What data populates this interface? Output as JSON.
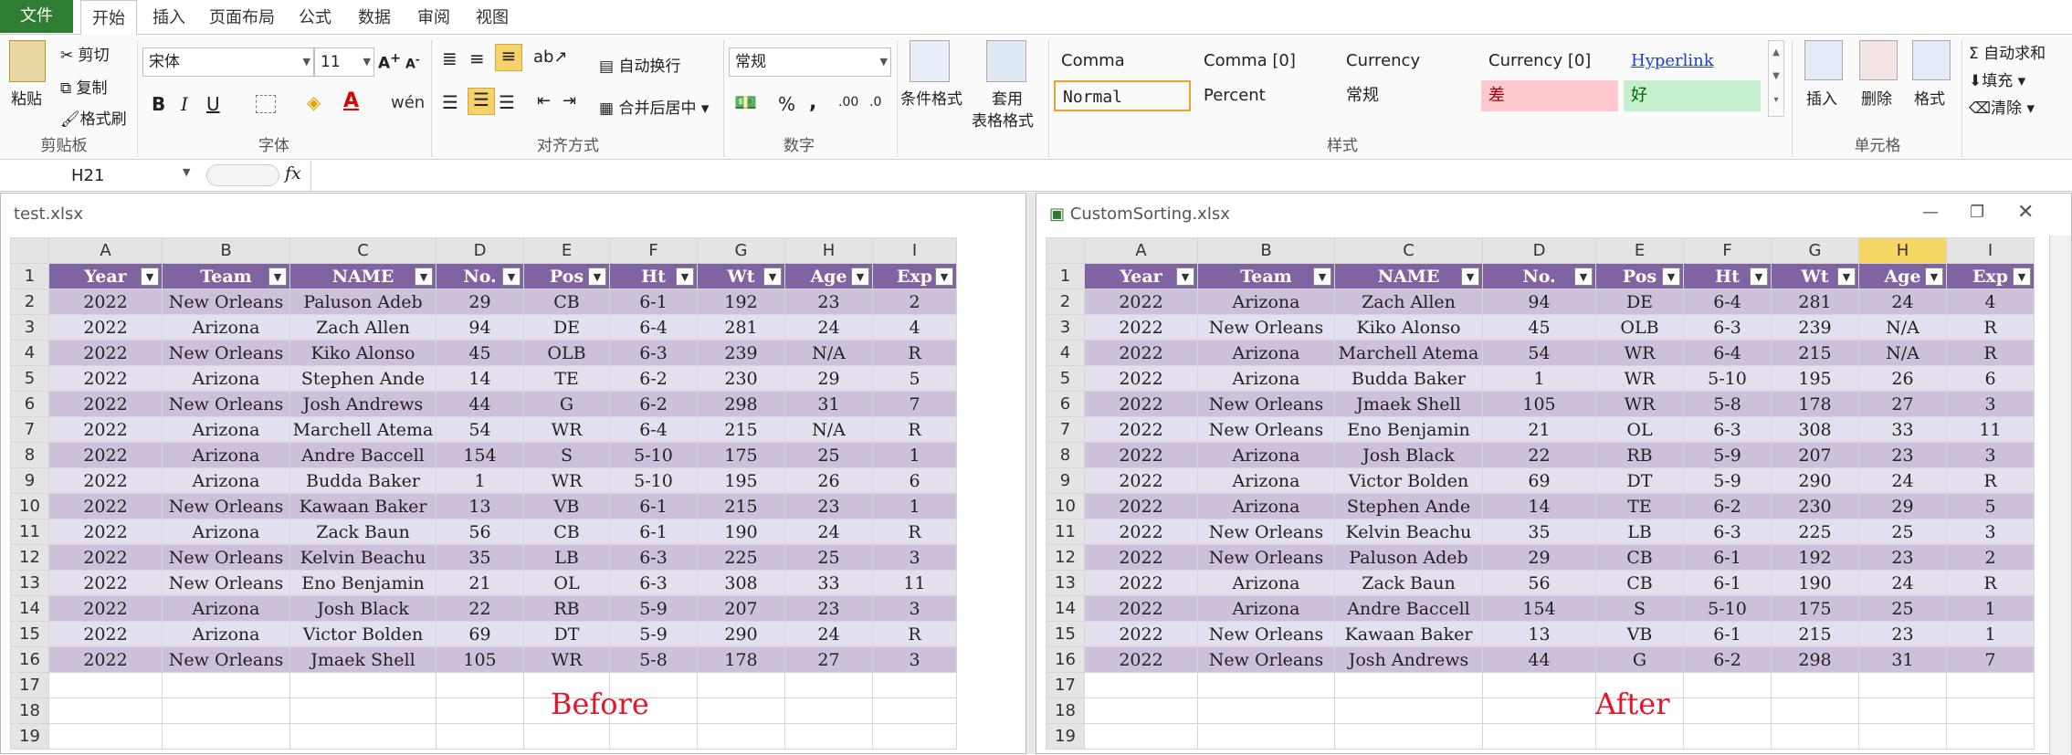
{
  "tabs": {
    "file": "文件",
    "home": "开始",
    "insert": "插入",
    "layout": "页面布局",
    "formulas": "公式",
    "data": "数据",
    "review": "审阅",
    "view": "视图"
  },
  "clipboard": {
    "paste": "粘贴",
    "cut": "剪切",
    "copy": "复制",
    "format_painter": "格式刷",
    "group": "剪贴板"
  },
  "font": {
    "name": "宋体",
    "size": "11",
    "bold": "B",
    "italic": "I",
    "underline": "U",
    "group": "字体"
  },
  "alignment": {
    "wrap": "自动换行",
    "merge": "合并后居中",
    "group": "对齐方式"
  },
  "number": {
    "format": "常规",
    "percent": "%",
    "comma": ",",
    "group": "数字"
  },
  "styles_btns": {
    "cond": "条件格式",
    "table": "套用",
    "table2": "表格格式"
  },
  "styles": {
    "group": "样式",
    "cells": [
      {
        "label": "Comma"
      },
      {
        "label": "Comma [0]"
      },
      {
        "label": "Currency"
      },
      {
        "label": "Currency [0]"
      },
      {
        "label": "Hyperlink"
      },
      {
        "label": "Normal"
      },
      {
        "label": "Percent"
      },
      {
        "label": "常规"
      },
      {
        "label": "差"
      },
      {
        "label": "好"
      }
    ]
  },
  "cells": {
    "insert": "插入",
    "delete": "删除",
    "format": "格式",
    "group": "单元格"
  },
  "editing": {
    "autosum": "自动求和",
    "fill": "填充",
    "clear": "清除"
  },
  "formula_bar": {
    "name_box": "H21",
    "fx": "fx",
    "value": ""
  },
  "left": {
    "title": "test.xlsx",
    "label": "Before",
    "cols": [
      "A",
      "B",
      "C",
      "D",
      "E",
      "F",
      "G",
      "H",
      "I"
    ],
    "headers": [
      "Year",
      "Team",
      "NAME",
      "No.",
      "Pos",
      "Ht",
      "Wt",
      "Age",
      "Exp"
    ],
    "rows": [
      [
        "2022",
        "New Orleans",
        "Paluson Adeb",
        "29",
        "CB",
        "6-1",
        "192",
        "23",
        "2"
      ],
      [
        "2022",
        "Arizona",
        "Zach Allen",
        "94",
        "DE",
        "6-4",
        "281",
        "24",
        "4"
      ],
      [
        "2022",
        "New Orleans",
        "Kiko Alonso",
        "45",
        "OLB",
        "6-3",
        "239",
        "N/A",
        "R"
      ],
      [
        "2022",
        "Arizona",
        "Stephen Ande",
        "14",
        "TE",
        "6-2",
        "230",
        "29",
        "5"
      ],
      [
        "2022",
        "New Orleans",
        "Josh Andrews",
        "44",
        "G",
        "6-2",
        "298",
        "31",
        "7"
      ],
      [
        "2022",
        "Arizona",
        "Marchell Atema",
        "54",
        "WR",
        "6-4",
        "215",
        "N/A",
        "R"
      ],
      [
        "2022",
        "Arizona",
        "Andre Baccell",
        "154",
        "S",
        "5-10",
        "175",
        "25",
        "1"
      ],
      [
        "2022",
        "Arizona",
        "Budda Baker",
        "1",
        "WR",
        "5-10",
        "195",
        "26",
        "6"
      ],
      [
        "2022",
        "New Orleans",
        "Kawaan Baker",
        "13",
        "VB",
        "6-1",
        "215",
        "23",
        "1"
      ],
      [
        "2022",
        "Arizona",
        "Zack Baun",
        "56",
        "CB",
        "6-1",
        "190",
        "24",
        "R"
      ],
      [
        "2022",
        "New Orleans",
        "Kelvin Beachu",
        "35",
        "LB",
        "6-3",
        "225",
        "25",
        "3"
      ],
      [
        "2022",
        "New Orleans",
        "Eno Benjamin",
        "21",
        "OL",
        "6-3",
        "308",
        "33",
        "11"
      ],
      [
        "2022",
        "Arizona",
        "Josh Black",
        "22",
        "RB",
        "5-9",
        "207",
        "23",
        "3"
      ],
      [
        "2022",
        "Arizona",
        "Victor Bolden",
        "69",
        "DT",
        "5-9",
        "290",
        "24",
        "R"
      ],
      [
        "2022",
        "New Orleans",
        "Jmaek Shell",
        "105",
        "WR",
        "5-8",
        "178",
        "27",
        "3"
      ]
    ]
  },
  "right": {
    "title": "CustomSorting.xlsx",
    "label": "After",
    "cols": [
      "A",
      "B",
      "C",
      "D",
      "E",
      "F",
      "G",
      "H",
      "I"
    ],
    "headers": [
      "Year",
      "Team",
      "NAME",
      "No.",
      "Pos",
      "Ht",
      "Wt",
      "Age",
      "Exp"
    ],
    "rows": [
      [
        "2022",
        "Arizona",
        "Zach Allen",
        "94",
        "DE",
        "6-4",
        "281",
        "24",
        "4"
      ],
      [
        "2022",
        "New Orleans",
        "Kiko Alonso",
        "45",
        "OLB",
        "6-3",
        "239",
        "N/A",
        "R"
      ],
      [
        "2022",
        "Arizona",
        "Marchell Atema",
        "54",
        "WR",
        "6-4",
        "215",
        "N/A",
        "R"
      ],
      [
        "2022",
        "Arizona",
        "Budda Baker",
        "1",
        "WR",
        "5-10",
        "195",
        "26",
        "6"
      ],
      [
        "2022",
        "New Orleans",
        "Jmaek Shell",
        "105",
        "WR",
        "5-8",
        "178",
        "27",
        "3"
      ],
      [
        "2022",
        "New Orleans",
        "Eno Benjamin",
        "21",
        "OL",
        "6-3",
        "308",
        "33",
        "11"
      ],
      [
        "2022",
        "Arizona",
        "Josh Black",
        "22",
        "RB",
        "5-9",
        "207",
        "23",
        "3"
      ],
      [
        "2022",
        "Arizona",
        "Victor Bolden",
        "69",
        "DT",
        "5-9",
        "290",
        "24",
        "R"
      ],
      [
        "2022",
        "Arizona",
        "Stephen Ande",
        "14",
        "TE",
        "6-2",
        "230",
        "29",
        "5"
      ],
      [
        "2022",
        "New Orleans",
        "Kelvin Beachu",
        "35",
        "LB",
        "6-3",
        "225",
        "25",
        "3"
      ],
      [
        "2022",
        "New Orleans",
        "Paluson Adeb",
        "29",
        "CB",
        "6-1",
        "192",
        "23",
        "2"
      ],
      [
        "2022",
        "Arizona",
        "Zack Baun",
        "56",
        "CB",
        "6-1",
        "190",
        "24",
        "R"
      ],
      [
        "2022",
        "Arizona",
        "Andre Baccell",
        "154",
        "S",
        "5-10",
        "175",
        "25",
        "1"
      ],
      [
        "2022",
        "New Orleans",
        "Kawaan Baker",
        "13",
        "VB",
        "6-1",
        "215",
        "23",
        "1"
      ],
      [
        "2022",
        "New Orleans",
        "Josh Andrews",
        "44",
        "G",
        "6-2",
        "298",
        "31",
        "7"
      ]
    ]
  },
  "empty_rows": [
    "17",
    "18",
    "19"
  ]
}
